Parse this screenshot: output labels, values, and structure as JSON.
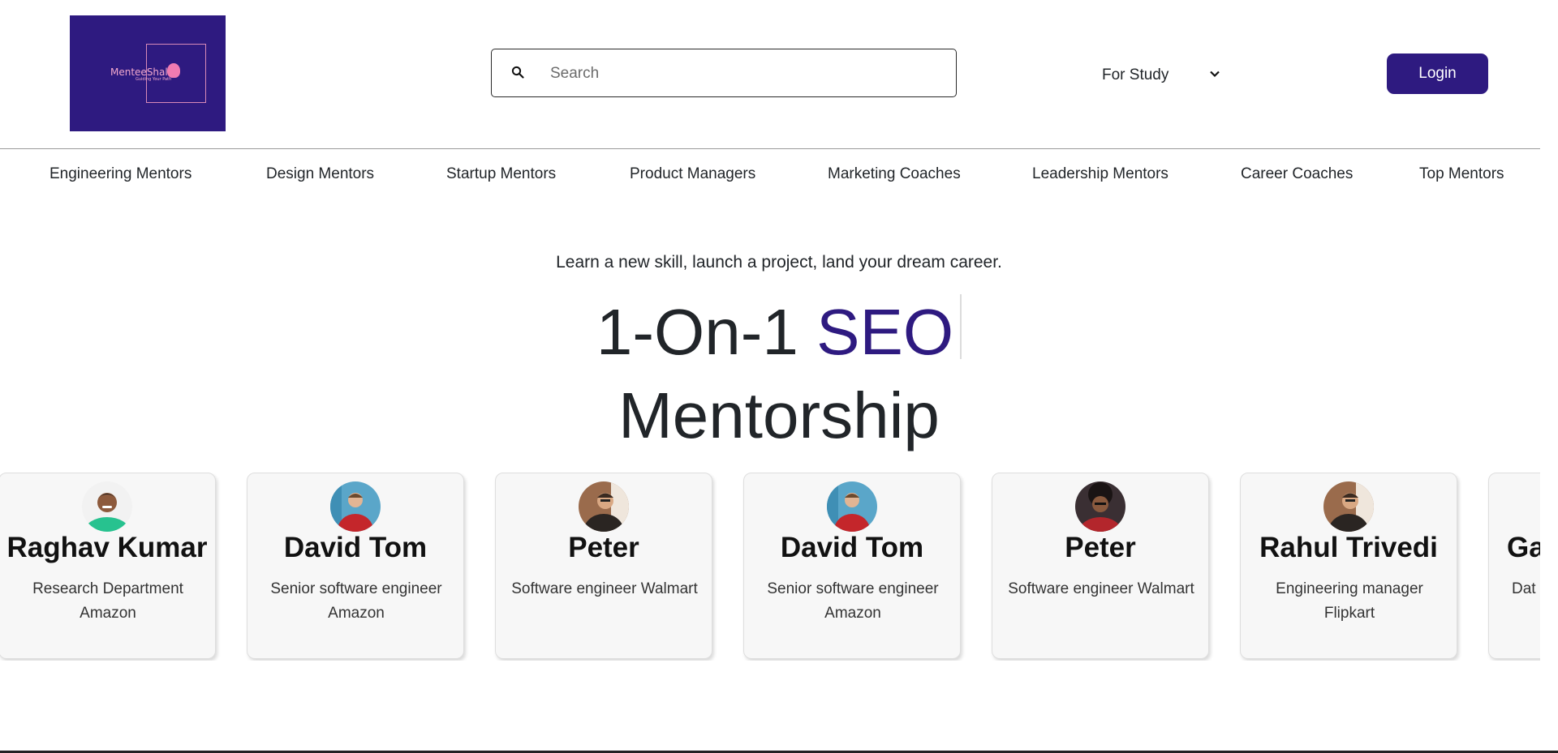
{
  "header": {
    "logo": {
      "brand_text": "MenteeShala",
      "tagline": "Guiding Your Path"
    },
    "search": {
      "placeholder": "Search",
      "value": ""
    },
    "study_select": {
      "selected": "For Study"
    },
    "login_label": "Login"
  },
  "categories": [
    "Engineering Mentors",
    "Design Mentors",
    "Startup Mentors",
    "Product Managers",
    "Marketing Coaches",
    "Leadership Mentors",
    "Career Coaches",
    "Top Mentors"
  ],
  "hero": {
    "tagline": "Learn a new skill, launch a project, land your dream career.",
    "headline_prefix": "1-On-1",
    "headline_keyword": "SEO",
    "headline_suffix": "Mentorship"
  },
  "mentors": [
    {
      "name": "Raghav Kumar",
      "role": "Research Department Amazon",
      "avatar": "person-green-shirt"
    },
    {
      "name": "David Tom",
      "role": "Senior software engineer Amazon",
      "avatar": "person-red-shirt"
    },
    {
      "name": "Peter",
      "role": "Software engineer Walmart",
      "avatar": "person-dark-jacket"
    },
    {
      "name": "David Tom",
      "role": "Senior software engineer Amazon",
      "avatar": "person-red-shirt"
    },
    {
      "name": "Peter",
      "role": "Software engineer Walmart",
      "avatar": "person-curly-hair"
    },
    {
      "name": "Rahul Trivedi",
      "role": "Engineering manager Flipkart",
      "avatar": "person-dark-jacket"
    },
    {
      "name": "Ga",
      "role": "Dat",
      "avatar": ""
    }
  ],
  "colors": {
    "brand": "#2e1a80",
    "logo_accent": "#f3a9cd"
  }
}
